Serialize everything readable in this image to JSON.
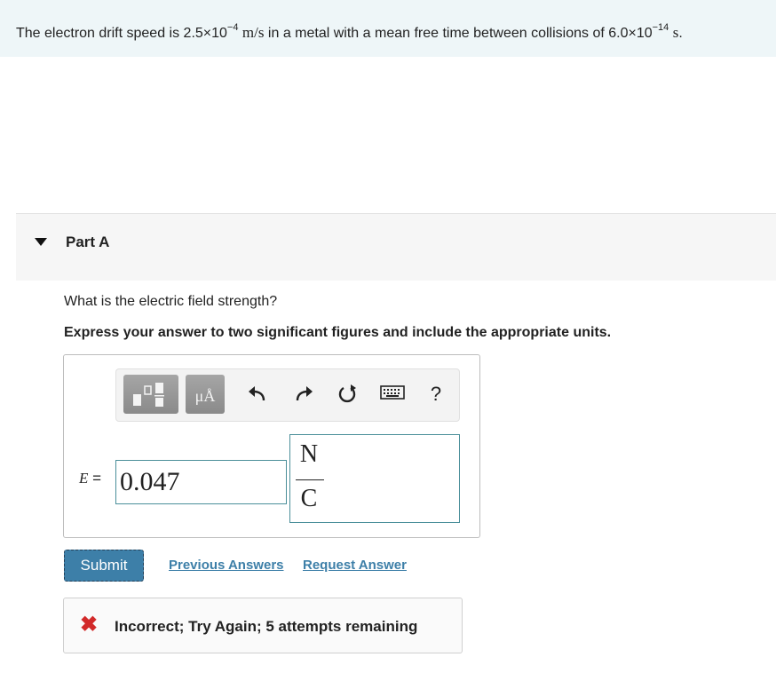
{
  "problem": {
    "text_before": "The electron drift speed is 2.5×10",
    "exp1": "−4",
    "unit_speed": "m/s",
    "text_middle": " in a metal with a mean free time between collisions of 6.0×10",
    "exp2": "−14",
    "unit_time": "s",
    "text_end": "."
  },
  "part": {
    "title": "Part A"
  },
  "question": {
    "text": "What is the electric field strength?",
    "instruction": "Express your answer to two significant figures and include the appropriate units."
  },
  "toolbar": {
    "buttons": [
      "templates-icon",
      "units-icon",
      "undo-icon",
      "redo-icon",
      "reset-icon",
      "keyboard-icon",
      "help-icon"
    ],
    "units_glyph": "μÅ",
    "help_glyph": "?"
  },
  "answer": {
    "variable": "E",
    "equals": "=",
    "value": "0.047",
    "unit_numerator": "N",
    "unit_denominator": "C"
  },
  "actions": {
    "submit_label": "Submit",
    "previous_label": "Previous Answers",
    "request_label": "Request Answer"
  },
  "feedback": {
    "message": "Incorrect; Try Again; 5 attempts remaining",
    "status_color": "#d22a2a"
  },
  "colors": {
    "accent": "#3d7fa8",
    "banner_bg": "#eef6f8",
    "input_border": "#4b8f9a"
  }
}
